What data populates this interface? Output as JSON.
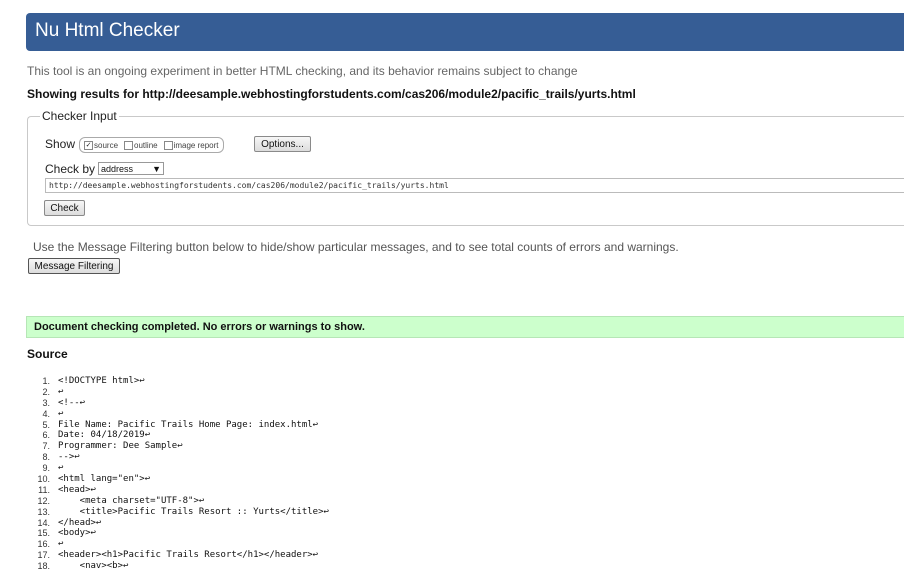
{
  "title": "Nu Html Checker",
  "intro": "This tool is an ongoing experiment in better HTML checking, and its behavior remains subject to change",
  "results_heading": "Showing results for http://deesample.webhostingforstudents.com/cas206/module2/pacific_trails/yurts.html",
  "checker_input": {
    "legend": "Checker Input",
    "show_label": "Show",
    "options": [
      {
        "label": "source",
        "checked": true
      },
      {
        "label": "outline",
        "checked": false
      },
      {
        "label": "image report",
        "checked": false
      }
    ],
    "options_button": "Options...",
    "check_by_label": "Check by",
    "check_by_value": "address",
    "url_value": "http://deesample.webhostingforstudents.com/cas206/module2/pacific_trails/yurts.html",
    "check_button": "Check"
  },
  "filter_text": "Use the Message Filtering button below to hide/show particular messages, and to see total counts of errors and warnings.",
  "filter_button": "Message Filtering",
  "success_message": "Document checking completed. No errors or warnings to show.",
  "source_heading": "Source",
  "source_lines": [
    {
      "n": "1.",
      "code": "<!DOCTYPE html>↩"
    },
    {
      "n": "2.",
      "code": "↩"
    },
    {
      "n": "3.",
      "code": "<!--↩"
    },
    {
      "n": "4.",
      "code": "↩"
    },
    {
      "n": "5.",
      "code": "File Name: Pacific Trails Home Page: index.html↩"
    },
    {
      "n": "6.",
      "code": "Date: 04/18/2019↩"
    },
    {
      "n": "7.",
      "code": "Programmer: Dee Sample↩"
    },
    {
      "n": "8.",
      "code": "-->↩"
    },
    {
      "n": "9.",
      "code": "↩"
    },
    {
      "n": "10.",
      "code": "<html lang=\"en\">↩"
    },
    {
      "n": "11.",
      "code": "<head>↩"
    },
    {
      "n": "12.",
      "code": "    <meta charset=\"UTF-8\">↩"
    },
    {
      "n": "13.",
      "code": "    <title>Pacific Trails Resort :: Yurts</title>↩"
    },
    {
      "n": "14.",
      "code": "</head>↩"
    },
    {
      "n": "15.",
      "code": "<body>↩"
    },
    {
      "n": "16.",
      "code": "↩"
    },
    {
      "n": "17.",
      "code": "<header><h1>Pacific Trails Resort</h1></header>↩"
    },
    {
      "n": "18.",
      "code": "    <nav><b>↩"
    }
  ],
  "colors": {
    "banner": "#365d95",
    "success_bg": "#ccffcc"
  }
}
